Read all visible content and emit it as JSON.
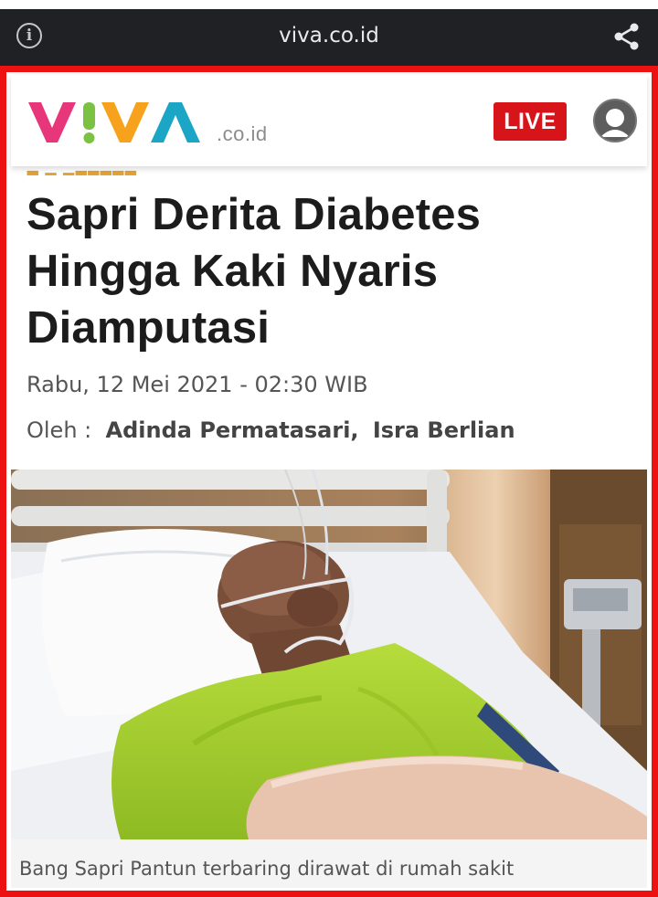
{
  "browser": {
    "url": "viva.co.id",
    "info_icon": "info-icon",
    "share_icon": "share-icon"
  },
  "header": {
    "logo_letters": "VIVA",
    "logo_tld": ".co.id",
    "live_label": "LIVE",
    "avatar_icon": "user-avatar-icon"
  },
  "article": {
    "title_lines": [
      "Sapri Derita Diabetes",
      "Hingga Kaki Nyaris",
      "Diamputasi"
    ],
    "date": "Rabu, 12 Mei 2021 - 02:30 WIB",
    "byline_label": "Oleh :",
    "authors": [
      "Adinda Permatasari,",
      "Isra Berlian"
    ],
    "caption": "Bang Sapri Pantun terbaring dirawat di rumah sakit"
  },
  "colors": {
    "highlight_border": "#ee1111",
    "live_badge": "#d8141b",
    "logo_v": "#e8367a",
    "logo_i": "#7cc242",
    "logo_v2": "#f6a21c",
    "logo_a": "#1ba6c6"
  }
}
